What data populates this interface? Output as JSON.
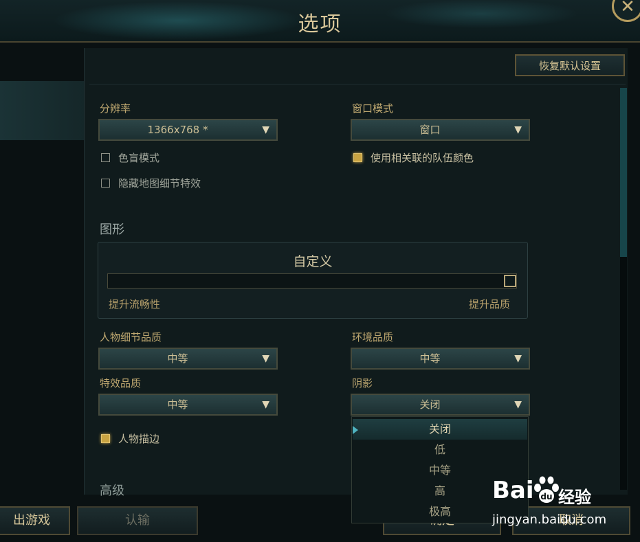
{
  "window": {
    "title": "选项",
    "close_glyph": "✕"
  },
  "toolbar": {
    "reset_label": "恢复默认设置"
  },
  "display": {
    "resolution_label": "分辨率",
    "resolution_value": "1366x768 *",
    "window_mode_label": "窗口模式",
    "window_mode_value": "窗口",
    "colorblind_label": "色盲模式",
    "colorblind_checked": false,
    "hide_map_effects_label": "隐藏地图细节特效",
    "hide_map_effects_checked": false,
    "team_colors_label": "使用相关联的队伍颜色",
    "team_colors_checked": true
  },
  "graphics": {
    "section_label": "图形",
    "preset_label": "自定义",
    "slider_left_label": "提升流畅性",
    "slider_right_label": "提升品质",
    "slider_level": 1.0,
    "character_quality_label": "人物细节品质",
    "character_quality_value": "中等",
    "environment_quality_label": "环境品质",
    "environment_quality_value": "中等",
    "effects_quality_label": "特效品质",
    "effects_quality_value": "中等",
    "shadow_label": "阴影",
    "shadow_value": "关闭",
    "shadow_options": [
      "关闭",
      "低",
      "中等",
      "高",
      "极高"
    ],
    "shadow_selected_index": 0,
    "outline_label": "人物描边",
    "outline_checked": true,
    "advanced_label": "高级"
  },
  "footer": {
    "exit_label": "出游戏",
    "surrender_label": "认输",
    "confirm_label": "确定",
    "cancel_label": "取消"
  },
  "watermark": {
    "brand": "Bai",
    "brand2": "经验",
    "url": "jingyan.baidu.com"
  },
  "icons": {
    "dropdown": "chevron-down-icon",
    "close": "close-icon",
    "paw": "baidu-paw-icon"
  },
  "colors": {
    "accent_gold": "#c9a443",
    "panel_bg": "#101b1c",
    "teal_accent": "#17454a"
  }
}
